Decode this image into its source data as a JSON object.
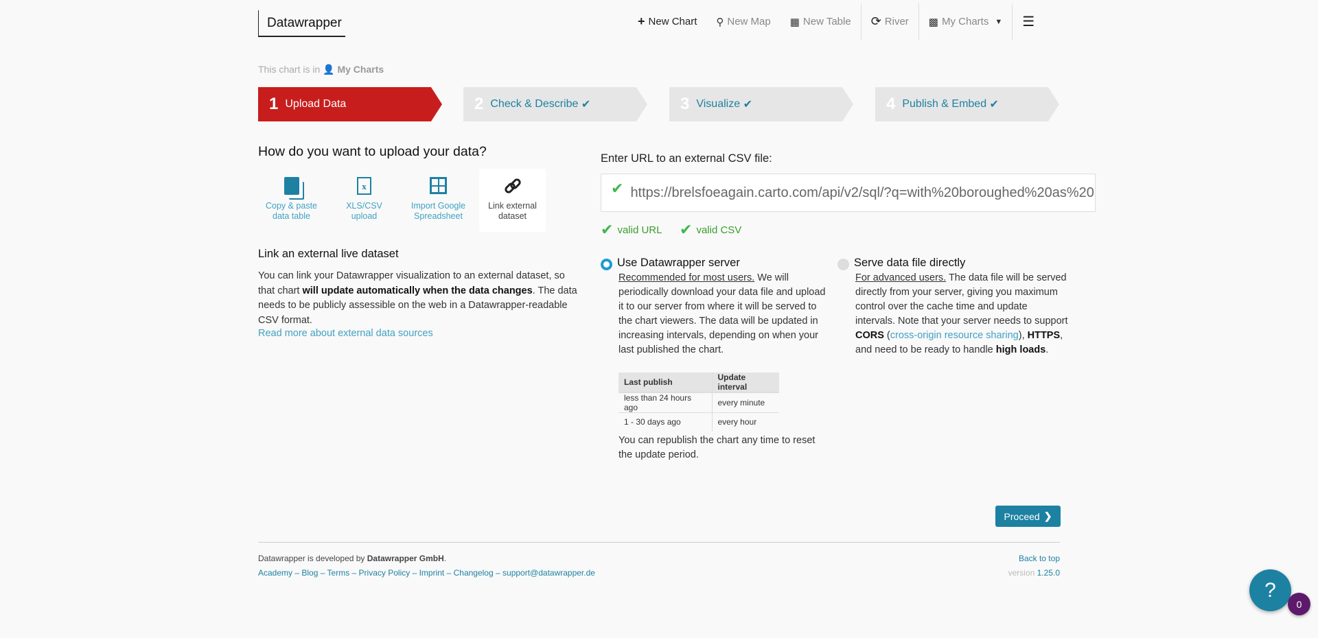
{
  "header": {
    "logo": "Datawrapper",
    "nav": [
      {
        "label": "New Chart",
        "icon": "plus-icon"
      },
      {
        "label": "New Map",
        "icon": "map-marker-icon"
      },
      {
        "label": "New Table",
        "icon": "table-icon"
      },
      {
        "label": "River",
        "icon": "river-icon"
      },
      {
        "label": "My Charts",
        "icon": "bar-chart-icon"
      }
    ]
  },
  "breadcrumb": {
    "prefix": "This chart is in",
    "folder": "My Charts"
  },
  "steps": [
    {
      "num": "1",
      "label": "Upload Data"
    },
    {
      "num": "2",
      "label": "Check & Describe"
    },
    {
      "num": "3",
      "label": "Visualize"
    },
    {
      "num": "4",
      "label": "Publish & Embed"
    }
  ],
  "left": {
    "heading": "How do you want to upload your data?",
    "options": [
      {
        "l1": "Copy & paste",
        "l2": "data table"
      },
      {
        "l1": "XLS/CSV",
        "l2": "upload"
      },
      {
        "l1": "Import Google",
        "l2": "Spreadsheet"
      },
      {
        "l1": "Link external",
        "l2": "dataset"
      }
    ],
    "subheading": "Link an external live dataset",
    "p1": "You can link your Datawrapper visualization to an external dataset, so that chart ",
    "p_bold": "will update automatically when the data changes",
    "p2": ". The data needs to be publicly assessible on the web in a Datawrapper-readable CSV format.",
    "read_more": "Read more about external data sources"
  },
  "right": {
    "url_label": "Enter URL to an external CSV file:",
    "url_value": "https://brelsfoeagain.carto.com/api/v2/sql/?q=with%20boroughed%20as%20",
    "valid_url": "valid URL",
    "valid_csv": "valid CSV",
    "server": {
      "title": "Use Datawrapper server",
      "u": "Recommended for most users.",
      "text": " We will periodically download your data file and upload it to our server from where it will be served to the chart viewers. The data will be updated in increasing intervals, depending on when your last published the chart.",
      "table": {
        "headers": [
          "Last publish",
          "Update interval"
        ],
        "rows": [
          [
            "less than 24 hours ago",
            "every minute"
          ],
          [
            "1 - 30 days ago",
            "every hour"
          ]
        ]
      },
      "note": "You can republish the chart any time to reset the update period."
    },
    "direct": {
      "title": "Serve data file directly",
      "u": "For advanced users.",
      "t1": " The data file will be served directly from your server, giving you maximum control over the cache time and update intervals. Note that your server needs to support ",
      "b1": "CORS",
      "t2": " (",
      "link": "cross-origin resource sharing",
      "t3": "), ",
      "b2": "HTTPS",
      "t4": ", and need to be ready to handle ",
      "b3": "high loads",
      "t5": "."
    }
  },
  "proceed": "Proceed",
  "footer": {
    "dev_prefix": "Datawrapper is developed by ",
    "dev_company": "Datawrapper GmbH",
    "links": [
      "Academy",
      "Blog",
      "Terms",
      "Privacy Policy",
      "Imprint",
      "Changelog",
      "support@datawrapper.de"
    ],
    "back_to_top": "Back to top",
    "version_label": "version",
    "version": "1.25.0"
  },
  "help": {
    "label": "?",
    "badge": "0"
  },
  "colors": {
    "accent": "#1d81a2",
    "active_step": "#c71e1d",
    "valid": "#3a9d2c",
    "badge": "#5e1a6a"
  }
}
